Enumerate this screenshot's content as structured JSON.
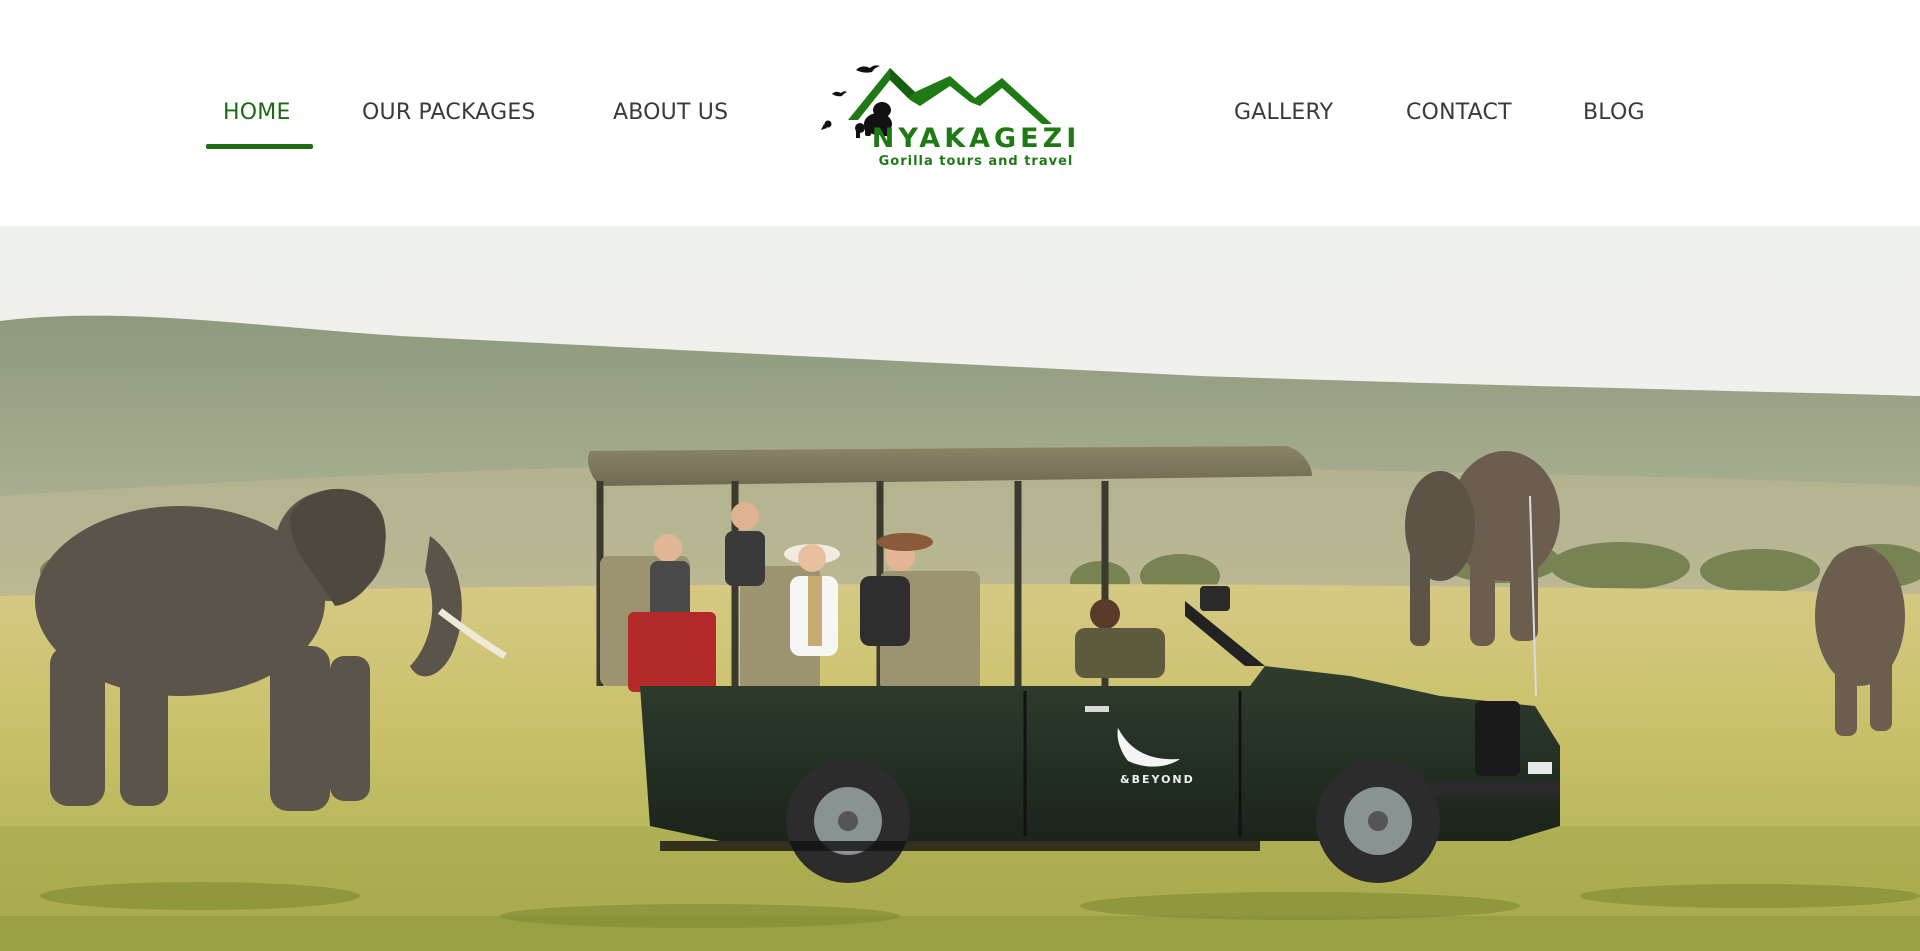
{
  "nav": {
    "left_items": [
      {
        "label": "HOME",
        "active": true
      },
      {
        "label": "OUR PACKAGES",
        "active": false
      },
      {
        "label": "ABOUT US",
        "active": false
      }
    ],
    "right_items": [
      {
        "label": "GALLERY",
        "active": false
      },
      {
        "label": "CONTACT",
        "active": false
      },
      {
        "label": "BLOG",
        "active": false
      }
    ],
    "active_color": "#1e6b14",
    "text_color": "#3a3a3a"
  },
  "logo": {
    "name": "NYAKAGEZI",
    "tagline": "Gorilla tours and travel",
    "color": "#1f7a16",
    "icons": [
      "mountains-icon",
      "gorilla-icon",
      "bird-icon"
    ]
  },
  "hero": {
    "vehicle_door_text": "&BEYOND",
    "icons": [
      "eagle-logo-icon"
    ]
  }
}
